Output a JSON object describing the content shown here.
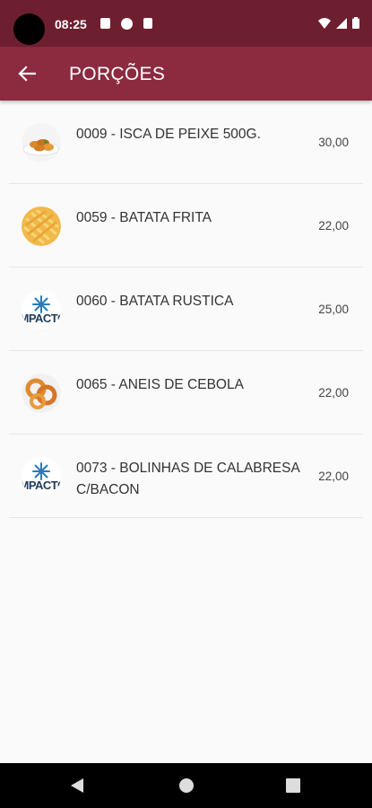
{
  "status_bar": {
    "time": "08:25",
    "icons": [
      "wifi-icon",
      "signal-icon",
      "battery-icon"
    ]
  },
  "app_bar": {
    "title": "PORÇÕES",
    "back_icon": "arrow-back-icon"
  },
  "items": [
    {
      "name": "0009 - ISCA DE PEIXE 500G.",
      "price": "30,00",
      "thumb": "fried-fish-photo"
    },
    {
      "name": "0059 - BATATA FRITA",
      "price": "22,00",
      "thumb": "french-fries-photo"
    },
    {
      "name": "0060 - BATATA RUSTICA",
      "price": "25,00",
      "thumb": "impacto-logo",
      "logo_text": "IMPACTO"
    },
    {
      "name": "0065 - ANEIS DE CEBOLA",
      "price": "22,00",
      "thumb": "onion-rings-photo"
    },
    {
      "name": "0073 - BOLINHAS DE CALABRESA C/BACON",
      "price": "22,00",
      "thumb": "impacto-logo",
      "logo_text": "IMPACTO"
    }
  ],
  "colors": {
    "status_bar": "#6e1f2f",
    "app_bar": "#8c2a3f",
    "background": "#fafafa"
  }
}
